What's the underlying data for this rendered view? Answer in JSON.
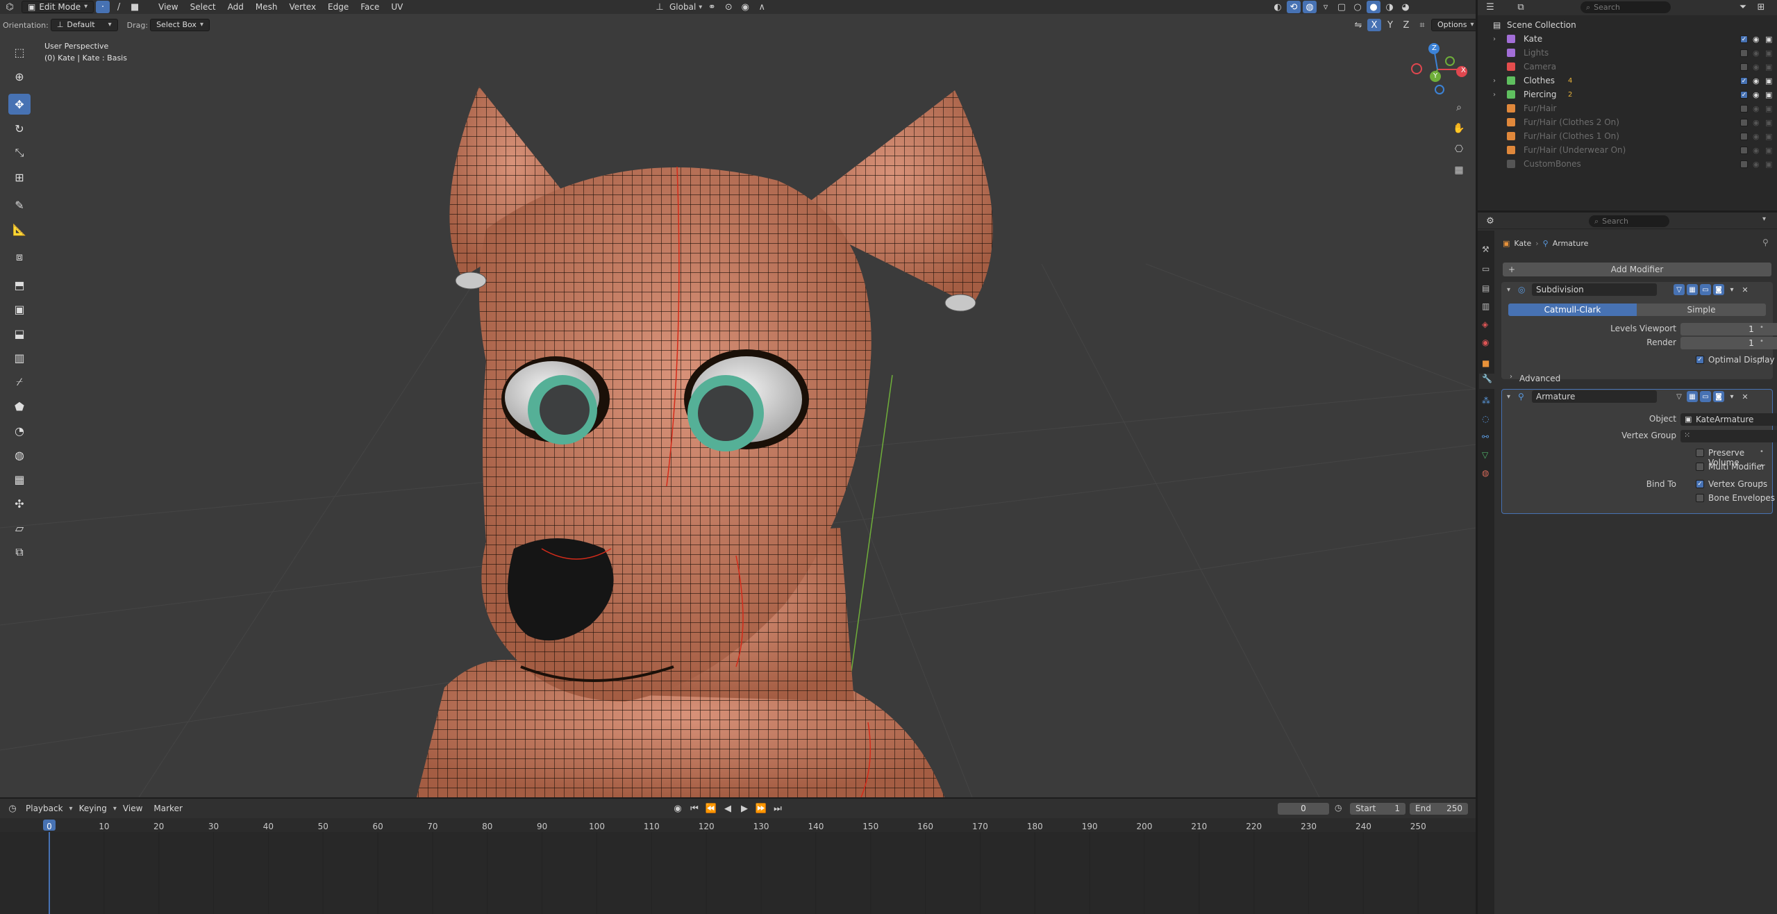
{
  "top_header": {
    "mode": "Edit Mode",
    "menus": [
      "View",
      "Select",
      "Add",
      "Mesh",
      "Vertex",
      "Edge",
      "Face",
      "UV"
    ],
    "transform_orientation": "Global",
    "search_placeholder": "Search"
  },
  "tool_header": {
    "orientation_label": "Orientation:",
    "orientation_value": "Default",
    "drag_label": "Drag:",
    "drag_value": "Select Box",
    "axes": [
      "X",
      "Y",
      "Z"
    ],
    "options_label": "Options"
  },
  "viewport": {
    "perspective": "User Perspective",
    "object_info": "(0) Kate | Kate : Basis",
    "gizmo_axes": {
      "x": "X",
      "y": "Y",
      "z": "Z"
    },
    "colors": {
      "x": "#e0474f",
      "y": "#6fae3a",
      "z": "#3c83d8",
      "mesh": "#c87f5e"
    }
  },
  "toolbar_icons": [
    "select-box-icon",
    "cursor-icon",
    "move-icon",
    "rotate-icon",
    "scale-icon",
    "transform-icon",
    "annotate-icon",
    "measure-icon",
    "add-cube-icon",
    "extrude-icon",
    "inset-icon",
    "bevel-icon",
    "loop-cut-icon",
    "knife-icon",
    "poly-build-icon",
    "spin-icon",
    "smooth-icon",
    "edge-slide-icon",
    "shrink-fatten-icon",
    "shear-icon",
    "rip-icon"
  ],
  "outliner": {
    "search_placeholder": "Search",
    "root": "Scene Collection",
    "items": [
      {
        "name": "Kate",
        "expand": true,
        "dim": false,
        "checked": true,
        "color": "#a26ed7"
      },
      {
        "name": "Lights",
        "expand": false,
        "dim": true,
        "checked": false,
        "color": "#a26ed7"
      },
      {
        "name": "Camera",
        "expand": false,
        "dim": true,
        "checked": false,
        "color": "#e44d4d"
      },
      {
        "name": "Clothes",
        "expand": true,
        "dim": false,
        "checked": true,
        "color": "#5fbf5f"
      },
      {
        "name": "Piercing",
        "expand": true,
        "dim": false,
        "checked": true,
        "color": "#5fbf5f"
      },
      {
        "name": "Fur/Hair",
        "expand": false,
        "dim": true,
        "checked": false,
        "color": "#e0883b"
      },
      {
        "name": "Fur/Hair (Clothes 2 On)",
        "expand": false,
        "dim": true,
        "checked": false,
        "color": "#e0883b"
      },
      {
        "name": "Fur/Hair (Clothes 1 On)",
        "expand": false,
        "dim": true,
        "checked": false,
        "color": "#e0883b"
      },
      {
        "name": "Fur/Hair (Underwear On)",
        "expand": false,
        "dim": true,
        "checked": false,
        "color": "#e0883b"
      },
      {
        "name": "CustomBones",
        "expand": false,
        "dim": true,
        "checked": false,
        "color": ""
      }
    ],
    "badges": {
      "clothes": "4",
      "piercing": "2"
    }
  },
  "properties": {
    "search_placeholder": "Search",
    "breadcrumb": {
      "object": "Kate",
      "modifier": "Armature"
    },
    "add_modifier": "Add Modifier",
    "subdivision": {
      "name": "Subdivision",
      "type_catmull": "Catmull-Clark",
      "type_simple": "Simple",
      "levels_viewport_label": "Levels Viewport",
      "levels_viewport": "1",
      "render_label": "Render",
      "render": "1",
      "optimal_display": "Optimal Display",
      "advanced": "Advanced"
    },
    "armature": {
      "name": "Armature",
      "object_label": "Object",
      "object_value": "KateArmature",
      "vertex_group_label": "Vertex Group",
      "preserve_volume": "Preserve Volume",
      "multi_modifier": "Multi Modifier",
      "bind_to_label": "Bind To",
      "vertex_groups": "Vertex Groups",
      "bone_envelopes": "Bone Envelopes"
    }
  },
  "timeline": {
    "menus": [
      "Playback",
      "Keying",
      "View",
      "Marker"
    ],
    "current_frame": "0",
    "start_label": "Start",
    "start": "1",
    "end_label": "End",
    "end": "250",
    "ruler": [
      "0",
      "10",
      "20",
      "30",
      "40",
      "50",
      "60",
      "70",
      "80",
      "90",
      "100",
      "110",
      "120",
      "130",
      "140",
      "150",
      "160",
      "170",
      "180",
      "190",
      "200",
      "210",
      "220",
      "230",
      "240",
      "250"
    ]
  }
}
